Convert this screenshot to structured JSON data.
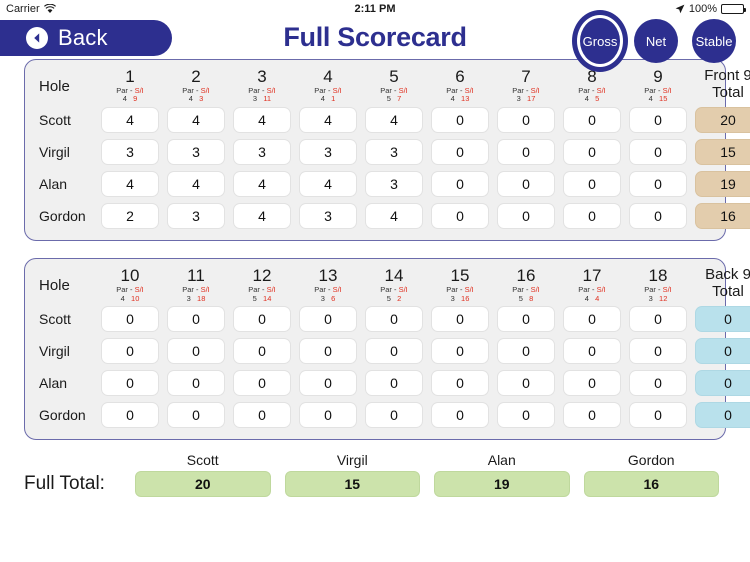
{
  "status_bar": {
    "carrier": "Carrier",
    "wifi_icon": "wifi-icon",
    "time": "2:11 PM",
    "location_icon": "location-arrow-icon",
    "battery_percent": "100%",
    "battery_icon": "battery-full-icon"
  },
  "navbar": {
    "back_label": "Back",
    "back_icon": "back-arrow-icon",
    "title": "Full Scorecard",
    "modes": [
      {
        "label": "Gross",
        "selected": true
      },
      {
        "label": "Net",
        "selected": false
      },
      {
        "label": "Stable",
        "selected": false
      }
    ]
  },
  "colors": {
    "brand_navy": "#2d2f8f",
    "si_red": "#e03020",
    "front_total_bg": "#e3cdad",
    "back_total_bg": "#b9e1ec",
    "full_total_bg": "#cce3ab",
    "panel_bg": "#f0f0f0",
    "panel_border": "#6b6bab"
  },
  "front_nine": {
    "hole_label": "Hole",
    "par_si_label": "Par  -  S/I",
    "total_label_line1": "Front 9",
    "total_label_line2": "Total",
    "holes": [
      {
        "number": "1",
        "par": "4",
        "si": "9"
      },
      {
        "number": "2",
        "par": "4",
        "si": "3"
      },
      {
        "number": "3",
        "par": "3",
        "si": "11"
      },
      {
        "number": "4",
        "par": "4",
        "si": "1"
      },
      {
        "number": "5",
        "par": "5",
        "si": "7"
      },
      {
        "number": "6",
        "par": "4",
        "si": "13"
      },
      {
        "number": "7",
        "par": "3",
        "si": "17"
      },
      {
        "number": "8",
        "par": "4",
        "si": "5"
      },
      {
        "number": "9",
        "par": "4",
        "si": "15"
      }
    ],
    "rows": [
      {
        "player": "Scott",
        "scores": [
          "4",
          "4",
          "4",
          "4",
          "4",
          "0",
          "0",
          "0",
          "0"
        ],
        "total": "20"
      },
      {
        "player": "Virgil",
        "scores": [
          "3",
          "3",
          "3",
          "3",
          "3",
          "0",
          "0",
          "0",
          "0"
        ],
        "total": "15"
      },
      {
        "player": "Alan",
        "scores": [
          "4",
          "4",
          "4",
          "4",
          "3",
          "0",
          "0",
          "0",
          "0"
        ],
        "total": "19"
      },
      {
        "player": "Gordon",
        "scores": [
          "2",
          "3",
          "4",
          "3",
          "4",
          "0",
          "0",
          "0",
          "0"
        ],
        "total": "16"
      }
    ]
  },
  "back_nine": {
    "hole_label": "Hole",
    "par_si_label": "Par  -  S/I",
    "total_label_line1": "Back 9",
    "total_label_line2": "Total",
    "holes": [
      {
        "number": "10",
        "par": "4",
        "si": "10"
      },
      {
        "number": "11",
        "par": "3",
        "si": "18"
      },
      {
        "number": "12",
        "par": "5",
        "si": "14"
      },
      {
        "number": "13",
        "par": "3",
        "si": "6"
      },
      {
        "number": "14",
        "par": "5",
        "si": "2"
      },
      {
        "number": "15",
        "par": "3",
        "si": "16"
      },
      {
        "number": "16",
        "par": "5",
        "si": "8"
      },
      {
        "number": "17",
        "par": "4",
        "si": "4"
      },
      {
        "number": "18",
        "par": "3",
        "si": "12"
      }
    ],
    "rows": [
      {
        "player": "Scott",
        "scores": [
          "0",
          "0",
          "0",
          "0",
          "0",
          "0",
          "0",
          "0",
          "0"
        ],
        "total": "0"
      },
      {
        "player": "Virgil",
        "scores": [
          "0",
          "0",
          "0",
          "0",
          "0",
          "0",
          "0",
          "0",
          "0"
        ],
        "total": "0"
      },
      {
        "player": "Alan",
        "scores": [
          "0",
          "0",
          "0",
          "0",
          "0",
          "0",
          "0",
          "0",
          "0"
        ],
        "total": "0"
      },
      {
        "player": "Gordon",
        "scores": [
          "0",
          "0",
          "0",
          "0",
          "0",
          "0",
          "0",
          "0",
          "0"
        ],
        "total": "0"
      }
    ]
  },
  "footer": {
    "label": "Full Total:",
    "players": [
      "Scott",
      "Virgil",
      "Alan",
      "Gordon"
    ],
    "totals": [
      "20",
      "15",
      "19",
      "16"
    ]
  }
}
